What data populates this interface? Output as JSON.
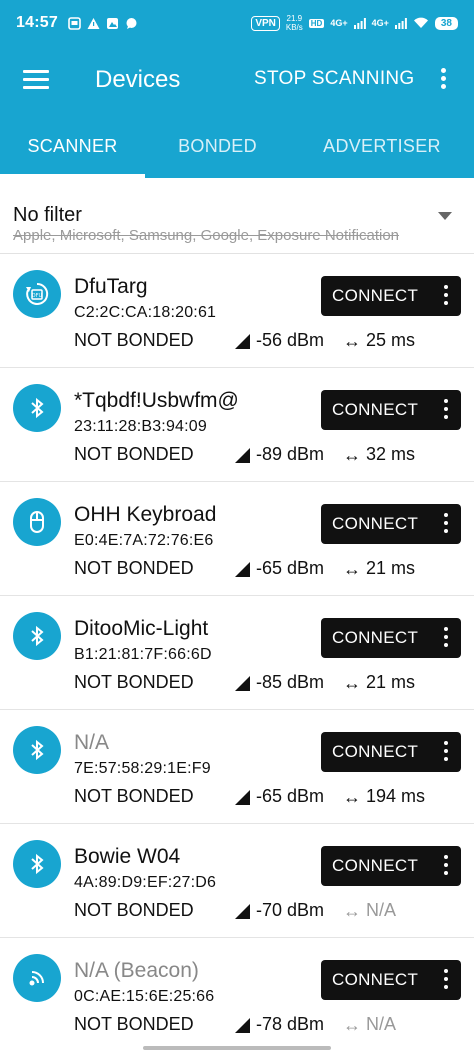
{
  "status_bar": {
    "time": "14:57",
    "vpn": "VPN",
    "speed_value": "21.9",
    "speed_unit": "KB/s",
    "hd": "HD",
    "net1": "4G+",
    "net2": "4G+",
    "battery": "38"
  },
  "app_bar": {
    "title": "Devices",
    "stop_scanning": "STOP SCANNING"
  },
  "tabs": [
    {
      "label": "SCANNER",
      "active": true
    },
    {
      "label": "BONDED",
      "active": false
    },
    {
      "label": "ADVERTISER",
      "active": false
    }
  ],
  "filter": {
    "title": "No filter",
    "subtitle": "Apple, Microsoft, Samsung, Google, Exposure Notification"
  },
  "connect_label": "CONNECT",
  "devices": [
    {
      "name": "DfuTarg",
      "address": "C2:2C:CA:18:20:61",
      "bond": "NOT BONDED",
      "rssi": "-56 dBm",
      "interval": "25 ms",
      "icon": "dfu-icon"
    },
    {
      "name": "*Tqbdf!Usbwfm@",
      "address": "23:11:28:B3:94:09",
      "bond": "NOT BONDED",
      "rssi": "-89 dBm",
      "interval": "32 ms",
      "icon": "bluetooth-icon"
    },
    {
      "name": "OHH Keybroad",
      "address": "E0:4E:7A:72:76:E6",
      "bond": "NOT BONDED",
      "rssi": "-65 dBm",
      "interval": "21 ms",
      "icon": "mouse-icon"
    },
    {
      "name": "DitooMic-Light",
      "address": "B1:21:81:7F:66:6D",
      "bond": "NOT BONDED",
      "rssi": "-85 dBm",
      "interval": "21 ms",
      "icon": "bluetooth-icon"
    },
    {
      "name": "N/A",
      "address": "7E:57:58:29:1E:F9",
      "bond": "NOT BONDED",
      "rssi": "-65 dBm",
      "interval": "194 ms",
      "icon": "bluetooth-icon"
    },
    {
      "name": "Bowie W04",
      "address": "4A:89:D9:EF:27:D6",
      "bond": "NOT BONDED",
      "rssi": "-70 dBm",
      "interval": "N/A",
      "icon": "bluetooth-icon"
    },
    {
      "name": "N/A  (Beacon)",
      "address": "0C:AE:15:6E:25:66",
      "bond": "NOT BONDED",
      "rssi": "-78 dBm",
      "interval": "N/A",
      "icon": "beacon-icon"
    }
  ],
  "colors": {
    "primary": "#18a5d0",
    "button": "#111111"
  }
}
